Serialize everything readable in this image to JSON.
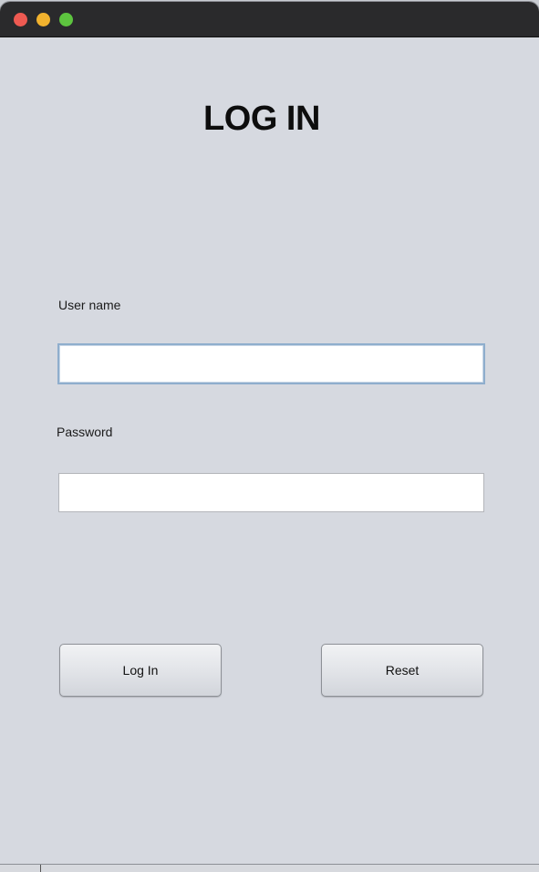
{
  "window": {
    "controls": {
      "close": "close-icon",
      "minimize": "minimize-icon",
      "zoom": "zoom-icon"
    }
  },
  "form": {
    "title": "LOG IN",
    "username_label": "User name",
    "username_value": "",
    "password_label": "Password",
    "password_value": ""
  },
  "buttons": {
    "login_label": "Log In",
    "reset_label": "Reset"
  },
  "colors": {
    "window_background": "#d6d9e0",
    "titlebar": "#2a2a2c",
    "close": "#ee5a52",
    "minimize": "#f1b22e",
    "zoom": "#5dc43f",
    "focus_ring": "#8faecd"
  }
}
